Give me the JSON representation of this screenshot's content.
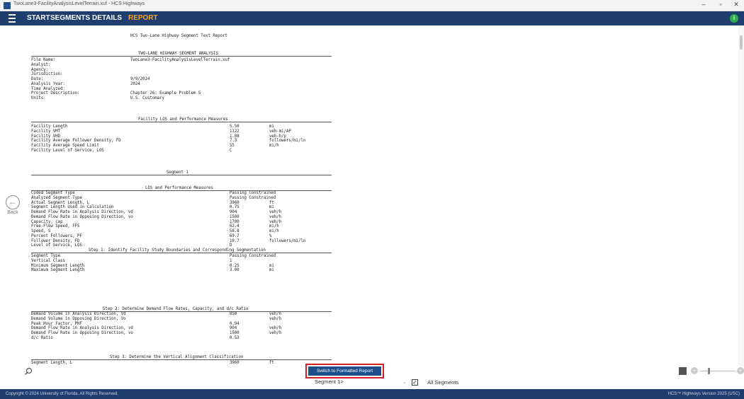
{
  "window": {
    "title": "TwoLane3-FacilityAnalysisLevelTerrain.xuf - HCS Highways"
  },
  "nav": {
    "tabs": [
      "START",
      "SEGMENTS",
      "DETAILS",
      "REPORT"
    ],
    "active": "REPORT"
  },
  "back_label": "Back",
  "report": {
    "title": "HCS Two-Lane Highway Segment Text Report",
    "sec_analysis": "TWO-LANE HIGHWAY SEGMENT ANALYSIS",
    "info": [
      [
        "File Name:",
        "TwoLane3-FacilityAnalysisLevelTerrain.xuf"
      ],
      [
        "Analyst:",
        ""
      ],
      [
        "Agency:",
        ""
      ],
      [
        "Jurisdiction:",
        ""
      ],
      [
        "Date:",
        "9/9/2024"
      ],
      [
        "Analysis Year:",
        "2024"
      ],
      [
        "Time Analyzed:",
        ""
      ],
      [
        "Project Description:",
        "Chapter 26: Example Problem 5"
      ],
      [
        "Units:",
        "U.S. Customary"
      ]
    ],
    "sec_facility": "Facility LOS and Performance Measures",
    "facility": [
      [
        "Facility Length",
        "5.50",
        "mi"
      ],
      [
        "Facility VMT",
        "1122",
        "veh-mi/AP"
      ],
      [
        "Facility VHD",
        "1.08",
        "veh-h/p"
      ],
      [
        "Facility Average Follower Density, FD",
        "7.3",
        "followers/mi/ln"
      ],
      [
        "Facility Average Speed Limit",
        "55",
        "mi/h"
      ],
      [
        "Facility Level of Service, LOS",
        "C",
        ""
      ]
    ],
    "sec_segment": "Segment 1",
    "sec_los": "LOS and Performance Measures",
    "segment": [
      [
        "Coded Segment Type",
        "Passing Constrained",
        ""
      ],
      [
        "Analyzed Segment Type",
        "Passing Constrained",
        ""
      ],
      [
        "Actual Segment Length, L",
        "3960",
        "ft"
      ],
      [
        "Segment Length Used in Calculation",
        "0.75",
        "mi"
      ],
      [
        "Demand Flow Rate in Analysis Direction, vd",
        "904",
        "veh/h"
      ],
      [
        "Demand Flow Rate in Opposing Direction, vo",
        "1500",
        "veh/h"
      ],
      [
        "Capacity, cap",
        "1700",
        "veh/h"
      ],
      [
        "Free-Flow Speed, FFS",
        "62.4",
        "mi/h"
      ],
      [
        "Speed, S",
        "58.8",
        "mi/h"
      ],
      [
        "Percent Followers, PF",
        "69.7",
        "%"
      ],
      [
        "Follower Density, FD",
        "10.7",
        "followers/mi/ln"
      ],
      [
        "Level of Service, LOS",
        "D",
        ""
      ]
    ],
    "sec_step1": "Step 1: Identify Facility Study Boundaries and Corresponding Segmentation",
    "step1": [
      [
        "Segment Type",
        "Passing Constrained",
        ""
      ],
      [
        "Vertical Class",
        "1",
        ""
      ],
      [
        "Minimum Segment Length",
        "0.25",
        "mi"
      ],
      [
        "Maximum Segment Length",
        "3.00",
        "mi"
      ]
    ],
    "sec_step2": "Step 2: Determine Demand Flow Rates, Capacity, and d/c Ratio",
    "step2": [
      [
        "Demand Volume in Analysis Direction, Vd",
        "850",
        "veh/h"
      ],
      [
        "Demand Volume in Opposing Direction, Vo",
        "",
        "veh/h"
      ],
      [
        "Peak Hour Factor, PHF",
        "0.94",
        ""
      ],
      [
        "Demand Flow Rate in Analysis Direction, vd",
        "904",
        "veh/h"
      ],
      [
        "Demand Flow Rate in Opposing Direction, vo",
        "1500",
        "veh/h"
      ],
      [
        "d/c Ratio",
        "0.53",
        ""
      ]
    ],
    "sec_step3": "Step 3: Determine the Vertical Alignment Classification",
    "step3": [
      [
        "Segment Length, L",
        "3960",
        "ft"
      ]
    ]
  },
  "controls": {
    "switch_label": "Switch to Formatted Report",
    "segment_value": "Segment 1>",
    "all_segments_label": "All Segments",
    "all_segments_checked": true
  },
  "footer": {
    "copyright": "Copyright © 2024 University of Florida. All Rights Reserved.",
    "version": "HCS™ Highways Version 2025 (USC)"
  },
  "colors": {
    "nav_bg": "#1d3e6f",
    "active_tab": "#f4a51c",
    "button_bg": "#1f4e8c",
    "highlight": "#d32027"
  },
  "icons": [
    "app-icon",
    "hamburger-icon",
    "info-icon",
    "back-arrow-icon",
    "search-icon",
    "view-icon",
    "zoom-minus-icon",
    "zoom-plus-icon",
    "checkbox-icon"
  ]
}
